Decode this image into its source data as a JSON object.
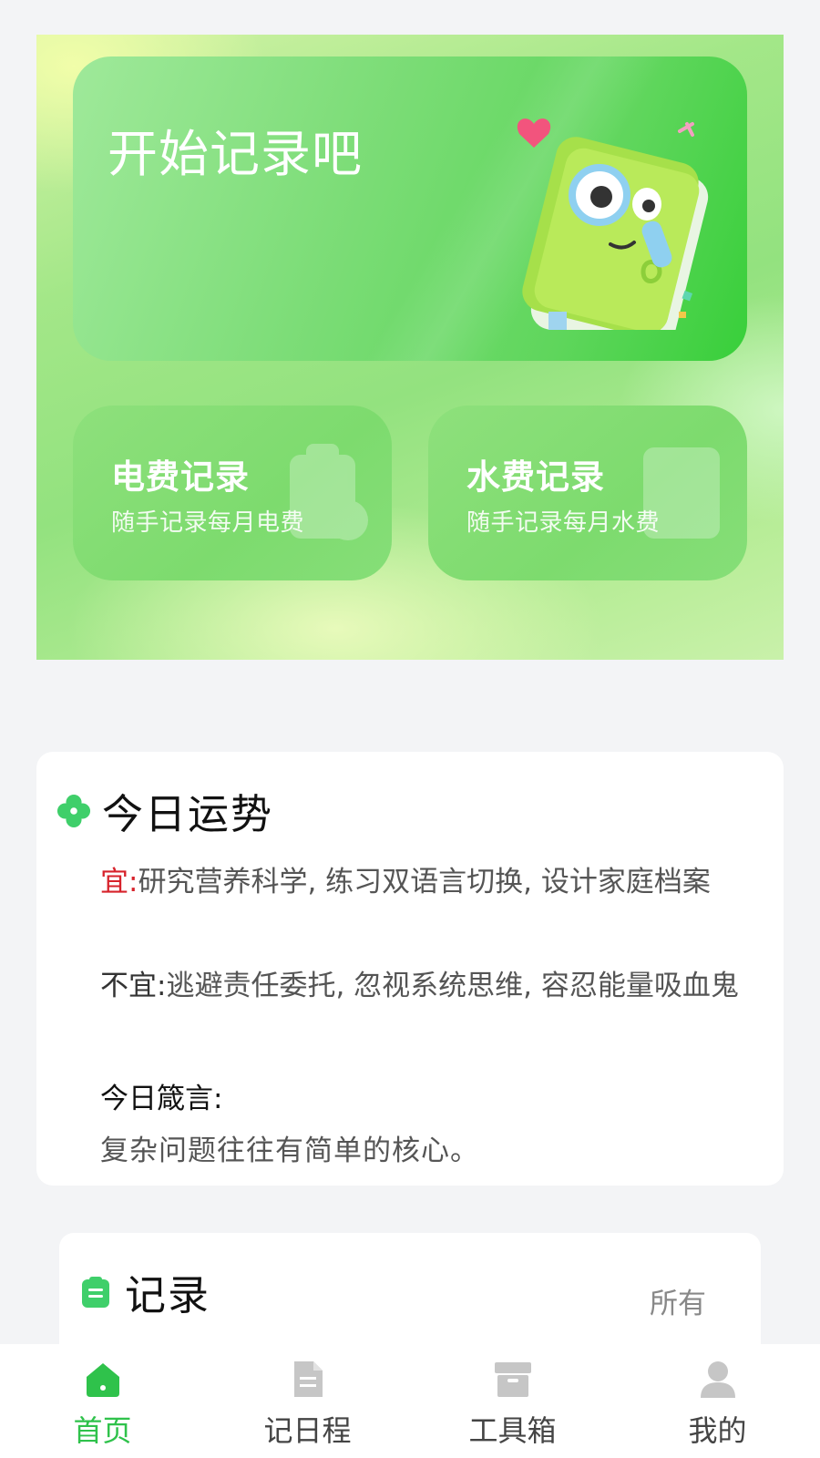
{
  "banner": {
    "title": "开始记录吧"
  },
  "cards": [
    {
      "title": "电费记录",
      "subtitle": "随手记录每月电费"
    },
    {
      "title": "水费记录",
      "subtitle": "随手记录每月水费"
    }
  ],
  "fortune": {
    "title": "今日运势",
    "good_label": "宜:",
    "good_text": "研究营养科学, 练习双语言切换, 设计家庭档案",
    "bad_label": "不宜:",
    "bad_text": "逃避责任委托, 忽视系统思维, 容忍能量吸血鬼",
    "motto_label": "今日箴言:",
    "motto_text": "复杂问题往往有简单的核心。"
  },
  "records": {
    "title": "记录",
    "filter": "所有"
  },
  "tabbar": {
    "items": [
      {
        "label": "首页",
        "icon": "home-icon",
        "active": true
      },
      {
        "label": "记日程",
        "icon": "document-icon",
        "active": false
      },
      {
        "label": "工具箱",
        "icon": "toolbox-icon",
        "active": false
      },
      {
        "label": "我的",
        "icon": "user-icon",
        "active": false
      }
    ]
  },
  "colors": {
    "accent_green": "#2fc24b",
    "good_red": "#d7222b",
    "banner_green": "#5fd65c"
  }
}
